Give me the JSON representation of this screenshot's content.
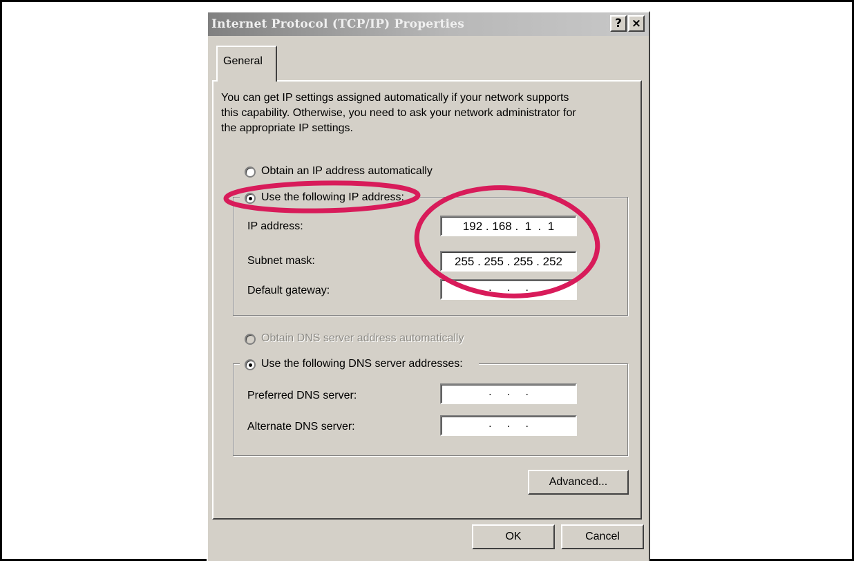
{
  "dialog": {
    "title": "Internet Protocol (TCP/IP) Properties",
    "help_button": "?",
    "close_button": "×"
  },
  "tabs": [
    {
      "label": "General"
    }
  ],
  "general": {
    "intro_lines": [
      "You can get IP settings assigned automatically if your network supports",
      "this capability. Otherwise, you need to ask your network administrator for",
      "the appropriate IP settings."
    ],
    "obtain_ip_auto": {
      "label": "Obtain an IP address automatically",
      "checked": false
    },
    "use_following_ip": {
      "label": "Use the following IP address:",
      "checked": true
    },
    "ip_address": {
      "label": "IP address:",
      "value": "192 . 168 .  1  .  1"
    },
    "subnet_mask": {
      "label": "Subnet mask:",
      "value": "255 . 255 . 255 . 252"
    },
    "default_gateway": {
      "label": "Default gateway:",
      "value": ".     .     ."
    },
    "obtain_dns_auto": {
      "label": "Obtain DNS server address automatically",
      "checked": false,
      "disabled": true
    },
    "use_following_dns": {
      "label": "Use the following DNS server addresses:",
      "checked": true
    },
    "preferred_dns": {
      "label": "Preferred DNS server:",
      "value": ".     .     ."
    },
    "alternate_dns": {
      "label": "Alternate DNS server:",
      "value": ".     .     ."
    },
    "advanced_button": "Advanced..."
  },
  "footer": {
    "ok_button": "OK",
    "cancel_button": "Cancel"
  },
  "colors": {
    "dialog_bg": "#d4d0c8",
    "annotation": "#d81b5a"
  }
}
